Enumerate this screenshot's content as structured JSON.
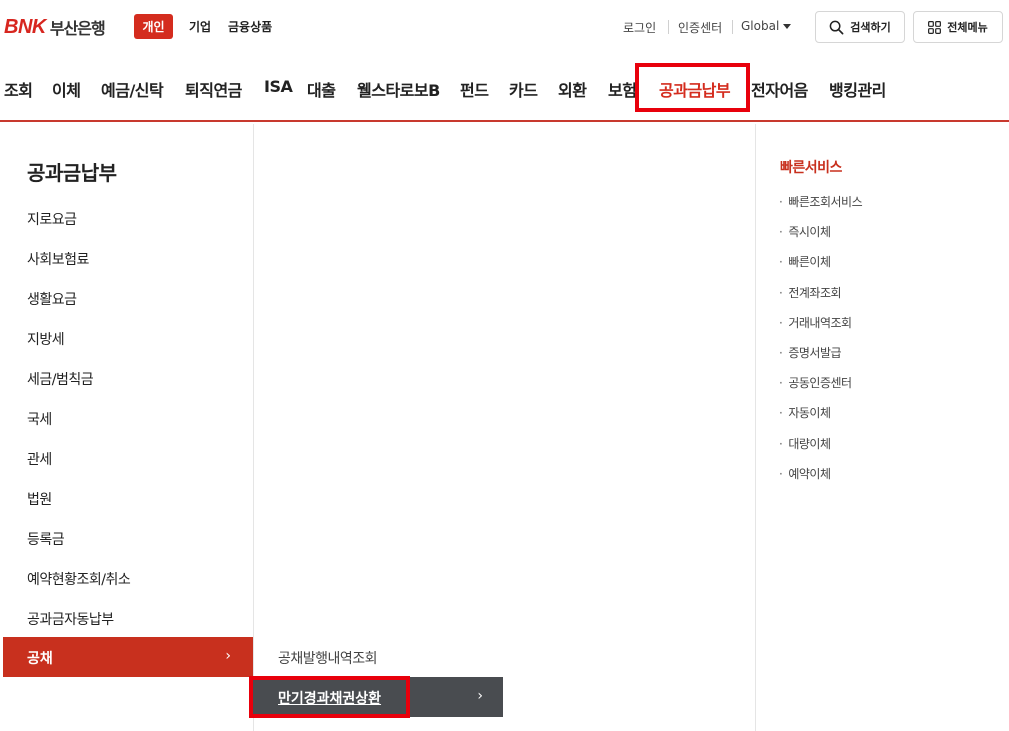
{
  "header": {
    "logo_mark": "BNK",
    "logo_name": "부산은행",
    "segments": [
      "개인",
      "기업",
      "금융상품"
    ],
    "util_links": [
      "로그인",
      "인증센터",
      "Global"
    ],
    "search_label": "검색하기",
    "allmenu_label": "전체메뉴"
  },
  "gnb": [
    "조회",
    "이체",
    "예금/신탁",
    "퇴직연금",
    "ISA",
    "대출",
    "웰스타로보B",
    "펀드",
    "카드",
    "외환",
    "보험",
    "공과금납부",
    "전자어음",
    "뱅킹관리"
  ],
  "left_menu": {
    "title": "공과금납부",
    "items": [
      "지로요금",
      "사회보험료",
      "생활요금",
      "지방세",
      "세금/범칙금",
      "국세",
      "관세",
      "법원",
      "등록금",
      "예약현황조회/취소",
      "공과금자동납부"
    ],
    "active": "공채"
  },
  "sub_menu": {
    "items": [
      "공채발행내역조회"
    ],
    "active": "만기경과채권상환"
  },
  "quick": {
    "title": "빠른서비스",
    "items": [
      "빠른조회서비스",
      "즉시이체",
      "빠른이체",
      "전계좌조회",
      "거래내역조회",
      "증명서발급",
      "공동인증센터",
      "자동이체",
      "대량이체",
      "예약이체"
    ]
  },
  "colors": {
    "brand": "#d42c1e",
    "highlight": "#e8000c",
    "submenu_dark": "#494c50"
  }
}
